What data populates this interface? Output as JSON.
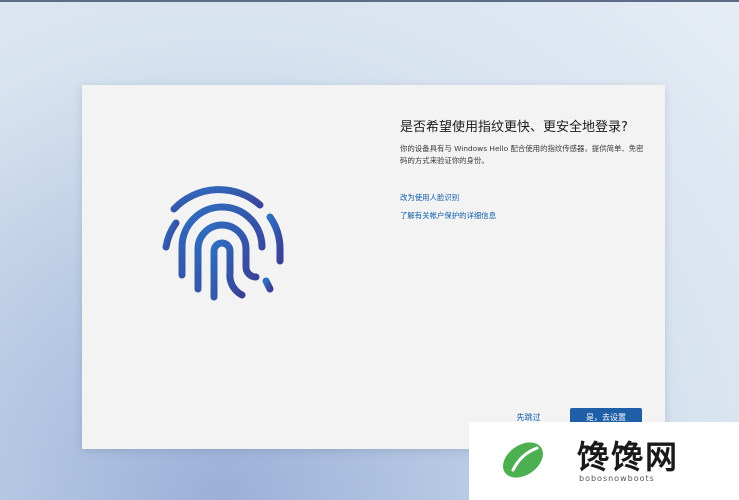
{
  "dialog": {
    "title": "是否希望使用指纹更快、更安全地登录?",
    "description": "你的设备具有与 Windows Hello 配合使用的指纹传感器，提供简单、免密码的方式来验证你的身份。",
    "links": [
      "改为使用人脸识别",
      "了解有关帐户保护的详细信息"
    ],
    "skip_label": "先跳过",
    "primary_label": "是，去设置"
  },
  "watermark": {
    "name": "馋馋网",
    "domain": "bobosnowboots"
  },
  "colors": {
    "accent": "#1f5fa8",
    "link": "#0b5cab",
    "fingerprint_start": "#2e6fc0",
    "fingerprint_end": "#3b3f96",
    "logo_green": "#4caf50"
  }
}
